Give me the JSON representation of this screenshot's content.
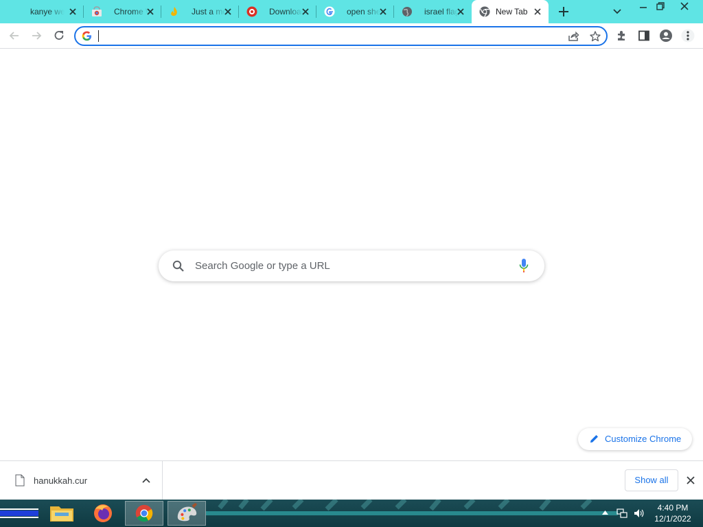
{
  "tabs": [
    {
      "title": "kanye west",
      "favicon": "kanye-favicon"
    },
    {
      "title": "Chrome Web Store",
      "favicon": "chrome-web-store-icon"
    },
    {
      "title": "Just a moment",
      "favicon": "flame-icon"
    },
    {
      "title": "Download",
      "favicon": "red-download-icon"
    },
    {
      "title": "open shell",
      "favicon": "google-g-icon"
    },
    {
      "title": "israel flag",
      "favicon": "globe-icon"
    },
    {
      "title": "New Tab",
      "favicon": "chrome-icon",
      "active": true
    }
  ],
  "omnibox": {
    "value": "",
    "placeholder": ""
  },
  "ntp": {
    "search_placeholder": "Search Google or type a URL",
    "customize_label": "Customize Chrome"
  },
  "downloads": {
    "items": [
      {
        "name": "hanukkah.cur"
      }
    ],
    "show_all_label": "Show all"
  },
  "taskbar": {
    "apps": [
      "file-explorer-icon",
      "firefox-icon",
      "chrome-icon",
      "paint-icon"
    ],
    "time": "4:40 PM",
    "date": "12/1/2022"
  },
  "colors": {
    "tabstrip": "#5fe4e4",
    "accent": "#1a73e8",
    "taskbar": "#1b4c55"
  }
}
